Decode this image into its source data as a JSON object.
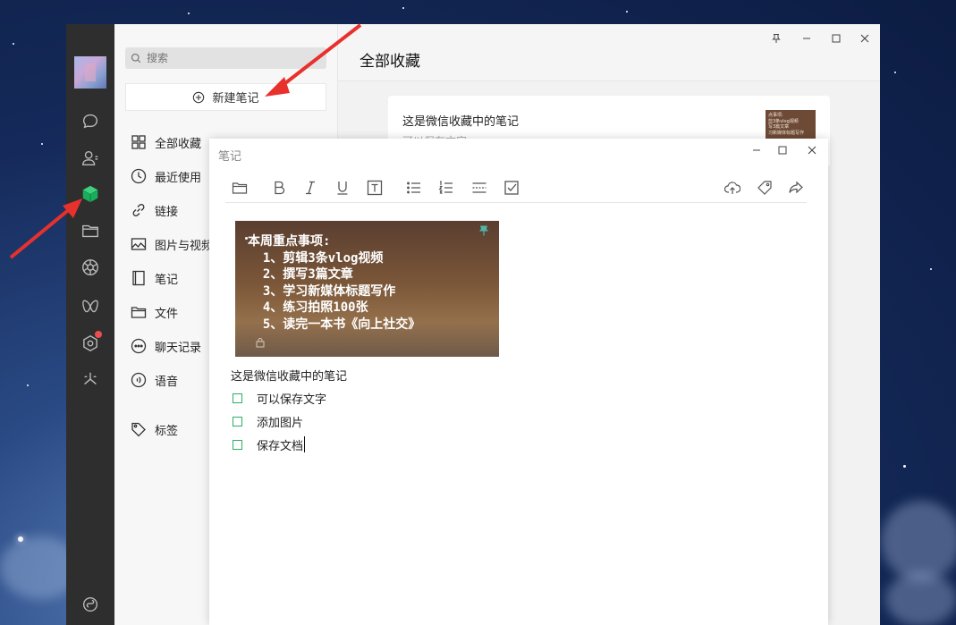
{
  "search": {
    "placeholder": "搜索"
  },
  "sidebar": {
    "new_note_label": "新建笔记",
    "items": [
      {
        "label": "全部收藏",
        "icon": "grid-icon"
      },
      {
        "label": "最近使用",
        "icon": "clock-icon"
      },
      {
        "label": "链接",
        "icon": "link-icon"
      },
      {
        "label": "图片与视频",
        "icon": "image-icon"
      },
      {
        "label": "笔记",
        "icon": "notebook-icon"
      },
      {
        "label": "文件",
        "icon": "folder-icon"
      },
      {
        "label": "聊天记录",
        "icon": "chat-bubble-icon"
      },
      {
        "label": "语音",
        "icon": "voice-icon"
      }
    ],
    "tags_label": "标签"
  },
  "main": {
    "title": "全部收藏",
    "card": {
      "title": "这是微信收藏中的笔记",
      "subtitle": "可以保存文字",
      "thumb_lines": [
        "点事项:",
        "剪3条vlog视频",
        "写3篇文章",
        "习新媒体标题写作"
      ]
    }
  },
  "note": {
    "window_title": "笔记",
    "image_lines": [
      "本周重点事项:",
      "  1、剪辑3条vlog视频",
      "  2、撰写3篇文章",
      "  3、学习新媒体标题写作",
      "  4、练习拍照100张",
      "  5、读完一本书《向上社交》"
    ],
    "body_text": "这是微信收藏中的笔记",
    "checklist": [
      "可以保存文字",
      "添加图片",
      "保存文档"
    ]
  },
  "colors": {
    "accent_green": "#2aae67",
    "annotation_red": "#e8312c",
    "rail_dark": "#2e2e2e"
  }
}
